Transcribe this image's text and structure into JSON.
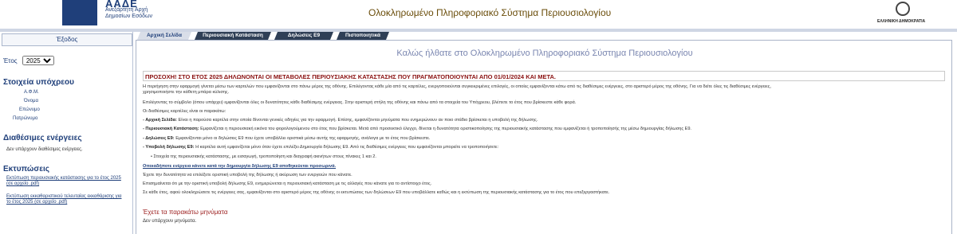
{
  "header": {
    "logo_title": "ΑΑΔΕ",
    "logo_line1": "Ανεξάρτητη Αρχή",
    "logo_line2": "Δημοσίων Εσόδων",
    "system_title": "Ολοκληρωμένο Πληροφοριακό Σύστημα Περιουσιολογίου",
    "emblem_caption": "ΕΛΛΗΝΙΚΗ ΔΗΜΟΚΡΑΤΙΑ"
  },
  "sidebar": {
    "exit_label": "Έξοδος",
    "year_label": "Έτος",
    "year_value": "2025",
    "obligated_title": "Στοιχεία υπόχρεου",
    "obligated_fields": [
      "Α.Φ.Μ.",
      "Όνομα",
      "Επώνυμο",
      "Πατρώνυμο"
    ],
    "declarations_title": "Διαθέσιμες ενέργειες",
    "declarations_text": "Δεν υπάρχουν διαθέσιμες ενέργειες.",
    "prints_title": "Εκτυπώσεις",
    "print_links": [
      "Εκτύπωση περιουσιακής κατάστασης για το έτος 2025 (σε αρχείο .pdf)",
      "Εκτύπωση εκκαθαριστικού τελευταίας εκκαθάρισης για το έτος 2025 (σε αρχείο .pdf)"
    ]
  },
  "tabs": [
    "Αρχική Σελίδα",
    "Περιουσιακή Κατάσταση",
    "Δηλώσεις Ε9",
    "Πιστοποιητικά"
  ],
  "main": {
    "welcome": "Καλώς ήλθατε στο Ολοκληρωμένο Πληροφοριακό Σύστημα Περιουσιολογίου",
    "warning": "ΠΡΟΣΟΧΗ! ΣΤΟ ΕΤΟΣ 2025 ΔΗΛΩΝΟΝΤΑΙ ΟΙ ΜΕΤΑΒΟΛΕΣ ΠΕΡΙΟΥΣΙΑΚΗΣ ΚΑΤΑΣΤΑΣΗΣ ΠΟΥ ΠΡΑΓΜΑΤΟΠΟΙΟΥΝΤΑΙ ΑΠΟ 01/01/2024 ΚΑΙ ΜΕΤΑ.",
    "p1": "Η περιήγηση στην εφαρμογή γίνεται μέσω των καρτελών που εμφανίζονται στο πάνω μέρος της οθόνης. Επιλέγοντας κάθε μία από τις καρτέλες, ενεργοποιούνται συγκεκριμένες επιλογές, οι οποίες εμφανίζονται κάτω από τις διαθέσιμες ενέργειες, στο αριστερό μέρος της οθόνης. Για να δείτε όλες τις διαθέσιμες ενέργειες,",
    "p1b": "χρησιμοποιήστε την κάθετη μπάρα κύλισης.",
    "p2": "Επιλέγοντας το σύμβολο (όπου υπάρχει) εμφανίζονται όλες οι δυνατότητες κάθε διαθέσιμης ενέργειας. Στην αριστερή στήλη της οθόνης και πάνω από τα στοιχεία του Υπόχρεου, βλέπετε το έτος που βρίσκεστε κάθε φορά.",
    "p3": "Οι διαθέσιμες καρτέλες είναι οι παρακάτω:",
    "b1_title": "- Αρχική Σελίδα:",
    "b1_text": "Είναι η παρούσα καρτέλα στην οποία δίνονται γενικές οδηγίες για την εφαρμογή. Επίσης, εμφανίζονται μηνύματα που ενημερώνουν αν ποιο στάδιο βρίσκεται η υποβολή της δήλωσης.",
    "b2_title": "- Περιουσιακή Κατάσταση:",
    "b2_text": "Εμφανίζεται η περιουσιακή εικόνα του φορολογούμενου στο έτος που βρίσκεται. Μετά από προσεκτικό έλεγχο, δίνεται η δυνατότητα οριστικοποίησης της περιουσιακής κατάστασης που εμφανίζεται ή τροποποίησής της μέσω δημιουργίας δήλωσης Ε9.",
    "b3_title": "- Δηλώσεις Ε9:",
    "b3_text": "Εμφανίζονται μόνο οι δηλώσεις Ε9 που έχετε υποβάλλει οριστικά μέσω αυτής της εφαρμογής, ανάλογα με το έτος που βρίσκεστε.",
    "b4_title": "- Υποβολή δήλωσης Ε9:",
    "b4_text": "Η καρτέλα αυτή εμφανίζεται μόνο όταν έχετε επιλέξει Δημιουργία δήλωσης Ε9. Από τις διαθέσιμες ενέργειες που εμφανίζονται μπορείτε να τροποποιήσετε:",
    "bullet": "Στοιχεία της περιουσιακής κατάστασης, με εισαγωγή, τροποποίηση και διαγραφή ακινήτων στους πίνακες 1 και 2.",
    "link": "Οποιαδήποτε ενέργεια κάνετε κατά την δημιουργία δήλωσης Ε9 αποθηκεύεται προσωρινά.",
    "p4": "Έχετε την δυνατότητα να επιλέξετε οριστική υποβολή της δήλωσης ή ακύρωση των ενεργειών που κάνατε.",
    "p5": "Επισημαίνεται ότι με την οριστική υποβολή δήλωσης Ε9, ενημερώνεται η περιουσιακή κατάσταση με τις αλλαγές που κάνατε για το αντίστοιχο έτος.",
    "p6": "Σε κάθε έτος, αφού ολοκληρώσετε τις ενέργειες σας, εμφανίζονται στο αριστερό μέρος της οθόνης οι εκτυπώσεις των δηλώσεων Ε9 που υποβάλλατε καθώς και η εκτύπωση της περιουσιακής κατάστασης για το έτος που επεξεργαστήκατε.",
    "messages_title": "Έχετε τα παρακάτω μηνύματα",
    "messages_none": "Δεν υπάρχουν μηνύματα."
  }
}
